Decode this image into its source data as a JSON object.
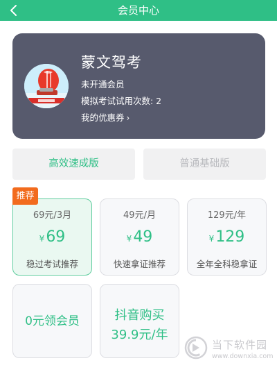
{
  "header": {
    "title": "会员中心",
    "back_icon": "chevron-left-icon"
  },
  "member_card": {
    "app_name": "蒙文驾考",
    "status": "未开通会员",
    "trial_label": "模拟考试试用次数: 2",
    "coupons_label": "我的优惠券",
    "coupons_arrow": "›"
  },
  "tabs": [
    {
      "label": "高效速成版",
      "active": true
    },
    {
      "label": "普通基础版",
      "active": false
    }
  ],
  "badge": "推荐",
  "plans": [
    {
      "title": "69元/3月",
      "currency": "¥",
      "price": "69",
      "desc": "稳过考试推荐",
      "selected": true
    },
    {
      "title": "49元/月",
      "currency": "¥",
      "price": "49",
      "desc": "快速拿证推荐",
      "selected": false
    },
    {
      "title": "129元/年",
      "currency": "¥",
      "price": "129",
      "desc": "全年全科稳拿证",
      "selected": false
    }
  ],
  "promos": [
    {
      "label": "0元领会员"
    },
    {
      "line1": "抖音购买",
      "line2": "39.9元/年"
    }
  ],
  "watermark": {
    "name": "当下软件园",
    "url": "www.downxia.com"
  },
  "colors": {
    "accent": "#2fbf86",
    "card_bg": "#575a6d",
    "badge": "#f26b1d"
  }
}
